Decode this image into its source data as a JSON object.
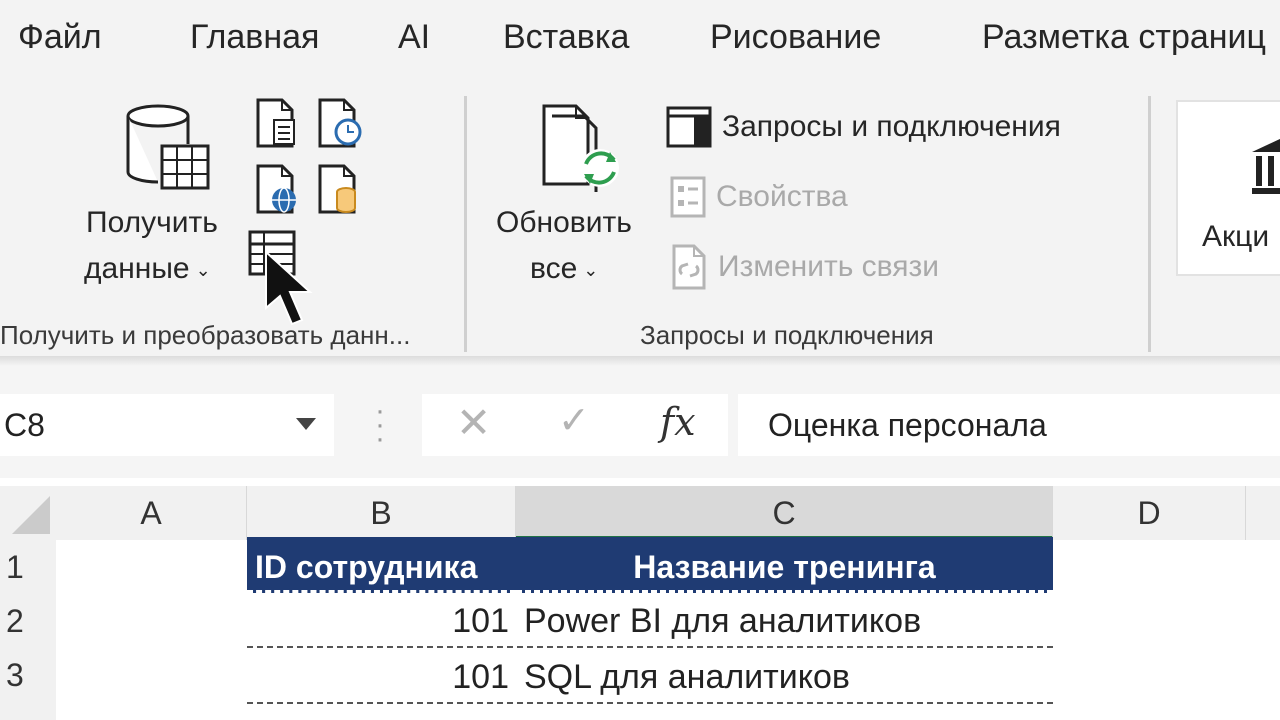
{
  "tabs": [
    "Файл",
    "Главная",
    "AI",
    "Вставка",
    "Рисование",
    "Разметка страниц"
  ],
  "ribbon": {
    "get_data": {
      "line1": "Получить",
      "line2": "данные",
      "chevron": "⌄"
    },
    "group1_label": "Получить и преобразовать данн...",
    "refresh": {
      "line1": "Обновить",
      "line2": "все",
      "chevron": "⌄"
    },
    "queries_connections": "Запросы и подключения",
    "properties": "Свойства",
    "edit_links": "Изменить связи",
    "group2_label": "Запросы и подключения",
    "stocks_partial": "Акци"
  },
  "formula_bar": {
    "name_box": "C8",
    "cancel_icon": "✕",
    "enter_icon": "✓",
    "fx_label": "fx",
    "formula": "Оценка персонала"
  },
  "grid": {
    "columns": [
      "A",
      "B",
      "C",
      "D"
    ],
    "rows": [
      "1",
      "2",
      "3"
    ],
    "header_row": [
      "ID сотрудника",
      "Название тренинга"
    ],
    "data_rows": [
      {
        "id": "101",
        "training": "Power BI для аналитиков"
      },
      {
        "id": "101",
        "training": "SQL для аналитиков"
      }
    ]
  },
  "colors": {
    "table_header_bg": "#1f3b73",
    "selected_col_accent": "#217346"
  }
}
